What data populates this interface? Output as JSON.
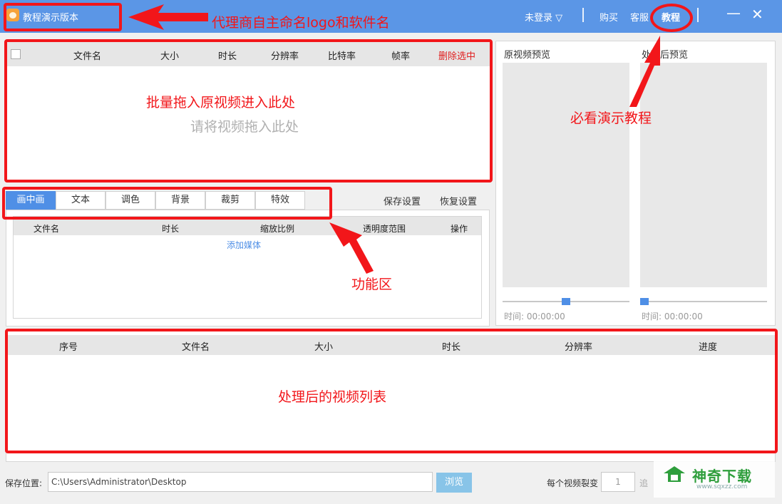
{
  "titlebar": {
    "app_name": "教程演示版本",
    "login": "未登录 ▽",
    "buy": "购买",
    "service": "客服",
    "tutorial": "教程",
    "minimize": "—",
    "close": "✕"
  },
  "source_list": {
    "columns": [
      "文件名",
      "大小",
      "时长",
      "分辨率",
      "比特率",
      "帧率"
    ],
    "delete_selected": "删除选中",
    "empty_hint": "请将视频拖入此处"
  },
  "tabs": [
    "画中画",
    "文本",
    "调色",
    "背景",
    "裁剪",
    "特效"
  ],
  "settings": {
    "save": "保存设置",
    "restore": "恢复设置"
  },
  "effect_table": {
    "columns": [
      "文件名",
      "时长",
      "缩放比例",
      "透明度范围",
      "操作"
    ],
    "add_media": "添加媒体"
  },
  "preview": {
    "original_title": "原视频预览",
    "processed_title": "处理后预览",
    "original_time": "时间: 00:00:00",
    "processed_time": "时间: 00:00:00",
    "original_progress": 0.5,
    "processed_progress": 0.0
  },
  "output_list": {
    "columns": [
      "序号",
      "文件名",
      "大小",
      "时长",
      "分辨率",
      "进度"
    ]
  },
  "footer": {
    "save_location_label": "保存位置:",
    "save_path": "C:\\Users\\Administrator\\Desktop",
    "browse": "浏览",
    "split_label": "每个视频裂变",
    "split_count": "1",
    "split_suffix": "追"
  },
  "annotations": {
    "logo_note": "代理商自主命名logo和软件名",
    "drop_note": "批量拖入原视频进入此处",
    "tutorial_note": "必看演示教程",
    "function_note": "功能区",
    "output_note": "处理后的视频列表"
  },
  "watermark": {
    "name": "神奇下载",
    "url": "www.sqxzz.com"
  },
  "colors": {
    "titlebar": "#5b96e6",
    "accent": "#4f8fe6",
    "annotation_red": "#f2161a",
    "watermark_green": "#2e9e3c"
  }
}
